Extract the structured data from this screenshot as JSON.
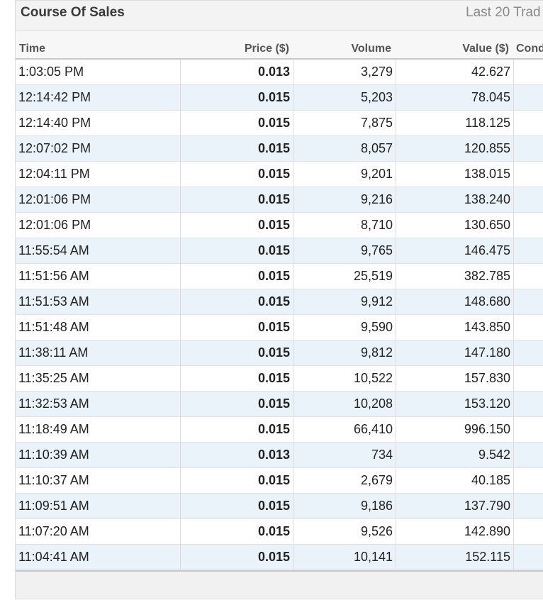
{
  "panel": {
    "title": "Course Of Sales",
    "subtitle": "Last 20 Trad"
  },
  "table": {
    "columns": {
      "time": "Time",
      "price": "Price ($)",
      "volume": "Volume",
      "value": "Value ($)",
      "condition": "Cond"
    },
    "rows": [
      {
        "time": "1:03:05 PM",
        "price": "0.013",
        "volume": "3,279",
        "value": "42.627",
        "condition": ""
      },
      {
        "time": "12:14:42 PM",
        "price": "0.015",
        "volume": "5,203",
        "value": "78.045",
        "condition": ""
      },
      {
        "time": "12:14:40 PM",
        "price": "0.015",
        "volume": "7,875",
        "value": "118.125",
        "condition": ""
      },
      {
        "time": "12:07:02 PM",
        "price": "0.015",
        "volume": "8,057",
        "value": "120.855",
        "condition": ""
      },
      {
        "time": "12:04:11 PM",
        "price": "0.015",
        "volume": "9,201",
        "value": "138.015",
        "condition": ""
      },
      {
        "time": "12:01:06 PM",
        "price": "0.015",
        "volume": "9,216",
        "value": "138.240",
        "condition": ""
      },
      {
        "time": "12:01:06 PM",
        "price": "0.015",
        "volume": "8,710",
        "value": "130.650",
        "condition": ""
      },
      {
        "time": "11:55:54 AM",
        "price": "0.015",
        "volume": "9,765",
        "value": "146.475",
        "condition": ""
      },
      {
        "time": "11:51:56 AM",
        "price": "0.015",
        "volume": "25,519",
        "value": "382.785",
        "condition": ""
      },
      {
        "time": "11:51:53 AM",
        "price": "0.015",
        "volume": "9,912",
        "value": "148.680",
        "condition": ""
      },
      {
        "time": "11:51:48 AM",
        "price": "0.015",
        "volume": "9,590",
        "value": "143.850",
        "condition": ""
      },
      {
        "time": "11:38:11 AM",
        "price": "0.015",
        "volume": "9,812",
        "value": "147.180",
        "condition": ""
      },
      {
        "time": "11:35:25 AM",
        "price": "0.015",
        "volume": "10,522",
        "value": "157.830",
        "condition": ""
      },
      {
        "time": "11:32:53 AM",
        "price": "0.015",
        "volume": "10,208",
        "value": "153.120",
        "condition": ""
      },
      {
        "time": "11:18:49 AM",
        "price": "0.015",
        "volume": "66,410",
        "value": "996.150",
        "condition": ""
      },
      {
        "time": "11:10:39 AM",
        "price": "0.013",
        "volume": "734",
        "value": "9.542",
        "condition": ""
      },
      {
        "time": "11:10:37 AM",
        "price": "0.015",
        "volume": "2,679",
        "value": "40.185",
        "condition": ""
      },
      {
        "time": "11:09:51 AM",
        "price": "0.015",
        "volume": "9,186",
        "value": "137.790",
        "condition": ""
      },
      {
        "time": "11:07:20 AM",
        "price": "0.015",
        "volume": "9,526",
        "value": "142.890",
        "condition": ""
      },
      {
        "time": "11:04:41 AM",
        "price": "0.015",
        "volume": "10,141",
        "value": "152.115",
        "condition": ""
      }
    ]
  }
}
